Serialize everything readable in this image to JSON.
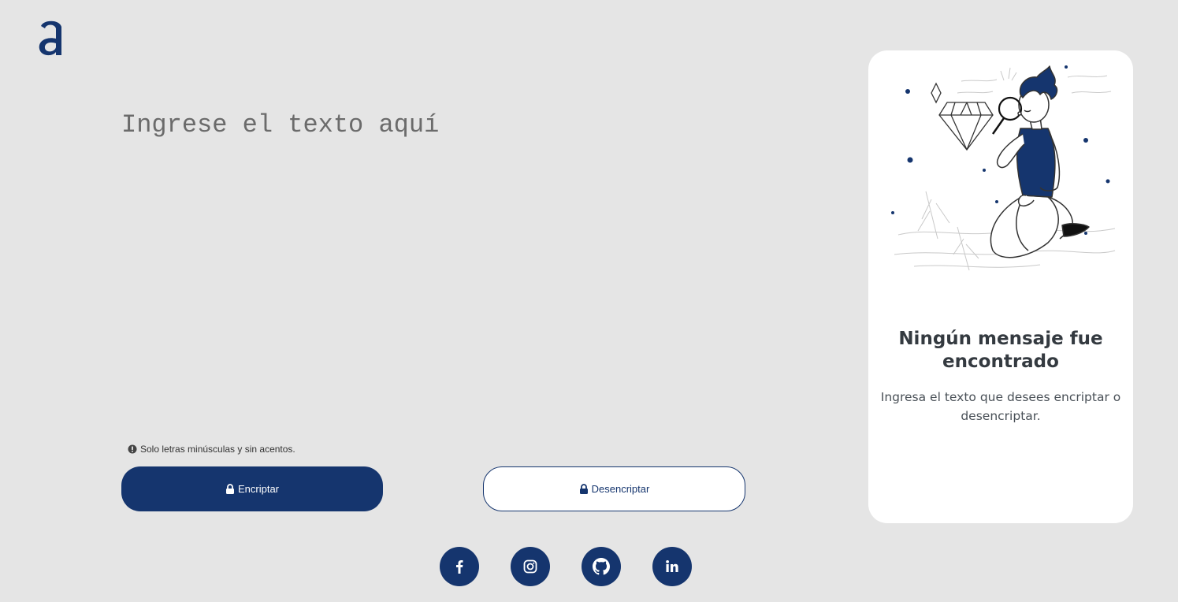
{
  "brand": {
    "logo_icon": "alura-a-logo",
    "color_primary": "#15356e",
    "color_background": "#e5e5e5"
  },
  "editor": {
    "placeholder": "Ingrese el texto aquí",
    "value": ""
  },
  "hint": {
    "icon": "exclamation-circle-icon",
    "text": "Solo letras minúsculas y sin acentos."
  },
  "buttons": {
    "encrypt_label": "Encriptar",
    "decrypt_label": "Desencriptar",
    "encrypt_icon": "lock-icon",
    "decrypt_icon": "unlock-icon"
  },
  "social": [
    {
      "name": "Facebook",
      "icon": "facebook-icon"
    },
    {
      "name": "Instagram",
      "icon": "instagram-icon"
    },
    {
      "name": "GitHub",
      "icon": "github-icon"
    },
    {
      "name": "LinkedIn",
      "icon": "linkedin-icon"
    }
  ],
  "result_panel": {
    "title": "Ningún mensaje fue encontrado",
    "message": "Ingresa el texto que desees encriptar o desencriptar.",
    "illustration": "person-with-magnifying-glass-illustration"
  }
}
